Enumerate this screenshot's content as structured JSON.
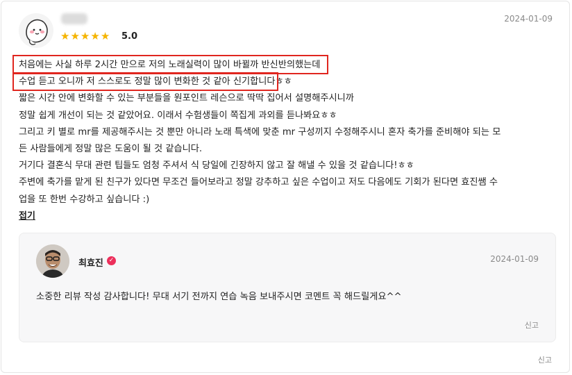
{
  "review": {
    "rating_stars": 5,
    "score": "5.0",
    "date": "2024-01-09",
    "lines": [
      "처음에는 사실 하루 2시간 만으로 저의 노래실력이 많이 바뀔까 반신반의했는데",
      "수업 듣고 오니까 저 스스로도 정말 많이 변화한 것 같아 신기합니다ㅎㅎ",
      "짧은 시간 안에 변화할 수 있는 부분들을 원포인트 레슨으로 딱딱 집어서 설명해주시니까",
      "정말 쉽게 개선이 되는 것 같았어요. 이래서 수험생들이 쪽집게 과외를 듣나봐요ㅎㅎ",
      "그리고 키 별로 mr를 제공해주시는 것 뿐만 아니라 노래 특색에 맞춘 mr 구성끼지 수정해주시니 혼자 축가를 준비해야 되는 모",
      "든 사람들에게 정말 많은 도움이 될 것 같습니다.",
      "거기다 결혼식 무대 관련 팁들도 엄청 주셔서 식 당일에 긴장하지 않고 잘 해낼 수 있을 것 같습니다!ㅎㅎ",
      "주변에 축가를 맡게 된 친구가 있다면 무조건 들어보라고 정말 강추하고 싶은 수업이고 저도 다음에도 기회가 된다면 효진쌤 수",
      "업을 또 한번 수강하고 싶습니다 :)"
    ],
    "fold_label": "접기",
    "report_label": "신고"
  },
  "reply": {
    "name": "최효진",
    "verified_icon": "✓",
    "date": "2024-01-09",
    "text": "소중한 리뷰 작성 감사합니다! 무대 서기 전까지 연습 녹음 보내주시면 코멘트 꼭 해드릴게요^^",
    "report_label": "신고"
  },
  "colors": {
    "star": "#f5b400",
    "highlight_box": "#e0261f",
    "verified_badge": "#ec2f5b",
    "reply_background": "#f7f7f8"
  }
}
